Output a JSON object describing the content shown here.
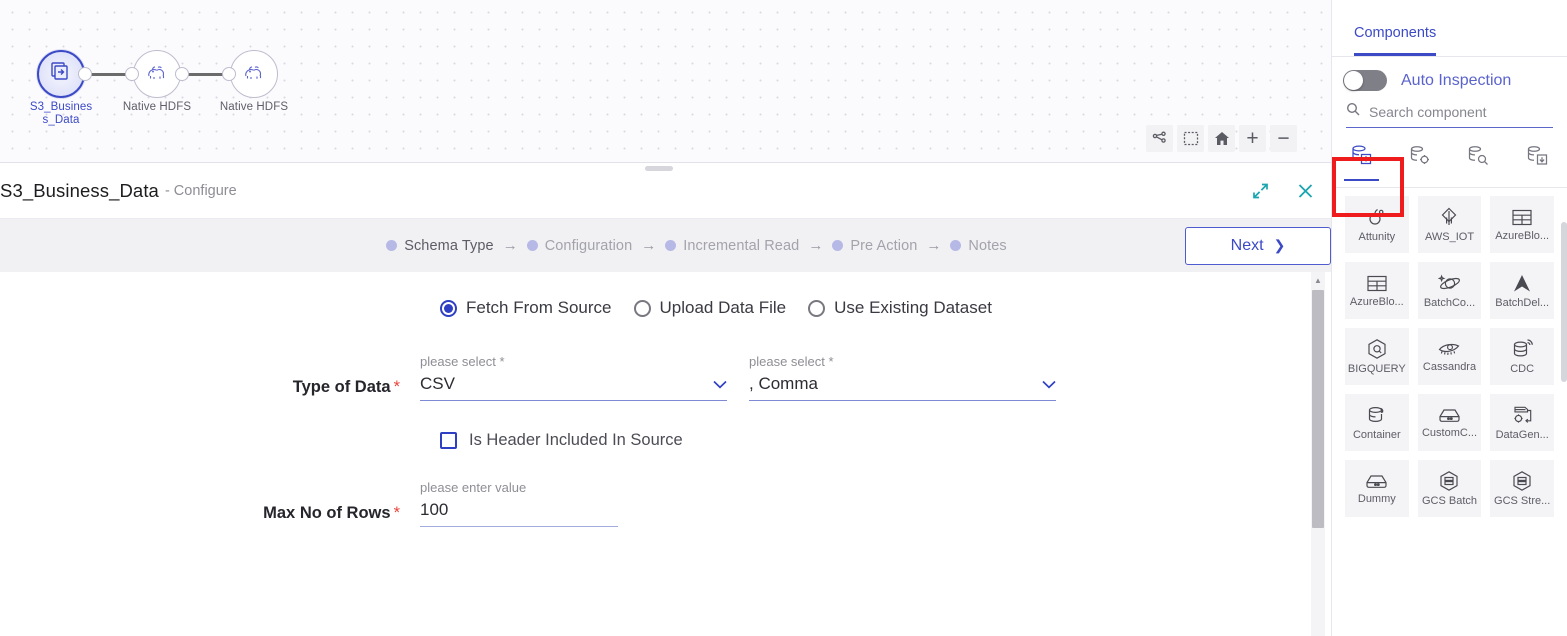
{
  "canvas": {
    "nodes": [
      {
        "label": "S3_Busines\ns_Data",
        "icon": "copy-documents-icon",
        "selected": true
      },
      {
        "label": "Native HDFS",
        "icon": "hadoop-elephant-icon",
        "selected": false
      },
      {
        "label": "Native HDFS",
        "icon": "hadoop-elephant-icon",
        "selected": false
      }
    ],
    "toolbar": [
      {
        "name": "layout-graph-icon",
        "label": ""
      },
      {
        "name": "selection-box-icon",
        "label": ""
      },
      {
        "name": "home-icon",
        "label": ""
      },
      {
        "name": "zoom-in-icon",
        "label": "+"
      },
      {
        "name": "zoom-out-icon",
        "label": "−"
      }
    ]
  },
  "config": {
    "title": "S3_Business_Data",
    "subtitle": "- Configure",
    "expand_icon": "expand-arrows-icon",
    "close_icon": "close-icon",
    "steps": [
      {
        "label": "Schema Type",
        "active": true
      },
      {
        "label": "Configuration",
        "active": false
      },
      {
        "label": "Incremental Read",
        "active": false
      },
      {
        "label": "Pre Action",
        "active": false
      },
      {
        "label": "Notes",
        "active": false
      }
    ],
    "step_arrow": "→",
    "next_label": "Next",
    "next_chevron": "❯",
    "source_options": [
      {
        "label": "Fetch From Source",
        "checked": true
      },
      {
        "label": "Upload Data File",
        "checked": false
      },
      {
        "label": "Use Existing Dataset",
        "checked": false
      }
    ],
    "fields": {
      "type_of_data": {
        "label": "Type of Data",
        "required": "*",
        "hint": "please select *",
        "value": "CSV"
      },
      "delimiter": {
        "hint": "please select *",
        "value": ", Comma"
      },
      "header_included": {
        "label": "Is Header Included In Source",
        "checked": false
      },
      "max_rows": {
        "label": "Max No of Rows",
        "required": "*",
        "hint": "please enter value",
        "value": "100"
      }
    }
  },
  "right_panel": {
    "tab": "Components",
    "auto_inspection": {
      "label": "Auto Inspection",
      "on": false
    },
    "search": {
      "placeholder": "Search component",
      "icon": "search-icon"
    },
    "category_tabs": [
      {
        "name": "db-upload-icon",
        "active": true
      },
      {
        "name": "db-gear-icon",
        "active": false
      },
      {
        "name": "db-search-icon",
        "active": false
      },
      {
        "name": "db-download-icon",
        "active": false
      }
    ],
    "components": [
      {
        "name": "Attunity",
        "icon": "attunity-icon"
      },
      {
        "name": "AWS_IOT",
        "icon": "aws-iot-icon"
      },
      {
        "name": "AzureBlo...",
        "icon": "table-grid-icon"
      },
      {
        "name": "AzureBlo...",
        "icon": "table-grid-icon"
      },
      {
        "name": "BatchCo...",
        "icon": "cosmos-planet-icon"
      },
      {
        "name": "BatchDel...",
        "icon": "delta-arrow-icon"
      },
      {
        "name": "BIGQUERY",
        "icon": "bigquery-hex-icon"
      },
      {
        "name": "Cassandra",
        "icon": "cassandra-eye-icon"
      },
      {
        "name": "CDC",
        "icon": "db-signal-icon"
      },
      {
        "name": "Container",
        "icon": "db-container-icon"
      },
      {
        "name": "CustomC...",
        "icon": "box-icon"
      },
      {
        "name": "DataGen...",
        "icon": "datagen-gear-icon"
      },
      {
        "name": "Dummy",
        "icon": "box-icon"
      },
      {
        "name": "GCS Batch",
        "icon": "hex-stack-icon"
      },
      {
        "name": "GCS Stre...",
        "icon": "hex-stack-icon"
      }
    ]
  }
}
